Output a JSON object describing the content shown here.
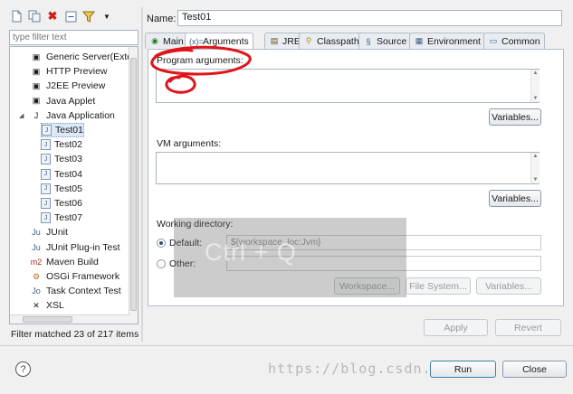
{
  "left_toolbar": {
    "icons": [
      "new-config-icon",
      "duplicate-icon",
      "delete-icon",
      "collapse-all-icon",
      "filter-icon"
    ]
  },
  "filter": {
    "placeholder": "type filter text"
  },
  "tree": {
    "items": [
      {
        "label": "Generic Server(Exter",
        "icon": "server-icon",
        "level": 1
      },
      {
        "label": "HTTP Preview",
        "icon": "http-icon",
        "level": 1
      },
      {
        "label": "J2EE Preview",
        "icon": "j2ee-icon",
        "level": 1
      },
      {
        "label": "Java Applet",
        "icon": "applet-icon",
        "level": 1
      },
      {
        "label": "Java Application",
        "icon": "java-app-icon",
        "level": 1,
        "expanded": true
      },
      {
        "label": "Test01",
        "icon": "java-file-icon",
        "level": 2,
        "selected": true
      },
      {
        "label": "Test02",
        "icon": "java-file-icon",
        "level": 2
      },
      {
        "label": "Test03",
        "icon": "java-file-icon",
        "level": 2
      },
      {
        "label": "Test04",
        "icon": "java-file-icon",
        "level": 2
      },
      {
        "label": "Test05",
        "icon": "java-file-icon",
        "level": 2
      },
      {
        "label": "Test06",
        "icon": "java-file-icon",
        "level": 2
      },
      {
        "label": "Test07",
        "icon": "java-file-icon",
        "level": 2
      },
      {
        "label": "JUnit",
        "icon": "junit-icon",
        "level": 1
      },
      {
        "label": "JUnit Plug-in Test",
        "icon": "junit-plugin-icon",
        "level": 1
      },
      {
        "label": "Maven Build",
        "icon": "maven-icon",
        "level": 1
      },
      {
        "label": "OSGi Framework",
        "icon": "osgi-icon",
        "level": 1
      },
      {
        "label": "Task Context Test",
        "icon": "task-context-icon",
        "level": 1
      },
      {
        "label": "XSL",
        "icon": "xsl-icon",
        "level": 1
      }
    ]
  },
  "filter_status": "Filter matched 23 of 217 items",
  "name": {
    "label": "Name:",
    "value": "Test01"
  },
  "tabs": [
    {
      "label": "Main",
      "icon": "main-tab-icon"
    },
    {
      "label": "Arguments",
      "icon": "arguments-tab-icon",
      "active": true
    },
    {
      "label": "JRE",
      "icon": "jre-tab-icon"
    },
    {
      "label": "Classpath",
      "icon": "classpath-tab-icon"
    },
    {
      "label": "Source",
      "icon": "source-tab-icon"
    },
    {
      "label": "Environment",
      "icon": "environment-tab-icon"
    },
    {
      "label": "Common",
      "icon": "common-tab-icon"
    }
  ],
  "arguments": {
    "program_label": "Program arguments:",
    "program_value": "",
    "program_variables_btn": "Variables...",
    "vm_label": "VM arguments:",
    "vm_value": "",
    "vm_variables_btn": "Variables...",
    "working_dir_label": "Working directory:",
    "default_label": "Default:",
    "default_value": "${workspace_loc:Jvm}",
    "other_label": "Other:",
    "other_value": "",
    "workspace_btn": "Workspace...",
    "filesystem_btn": "File System...",
    "dir_variables_btn": "Variables..."
  },
  "buttons": {
    "apply": "Apply",
    "revert": "Revert",
    "run": "Run",
    "close": "Close"
  },
  "overlay_text": "Ctrl + Q",
  "watermark": "https://blog.csdn.net/",
  "annotations": {
    "color": "#e0141b"
  }
}
